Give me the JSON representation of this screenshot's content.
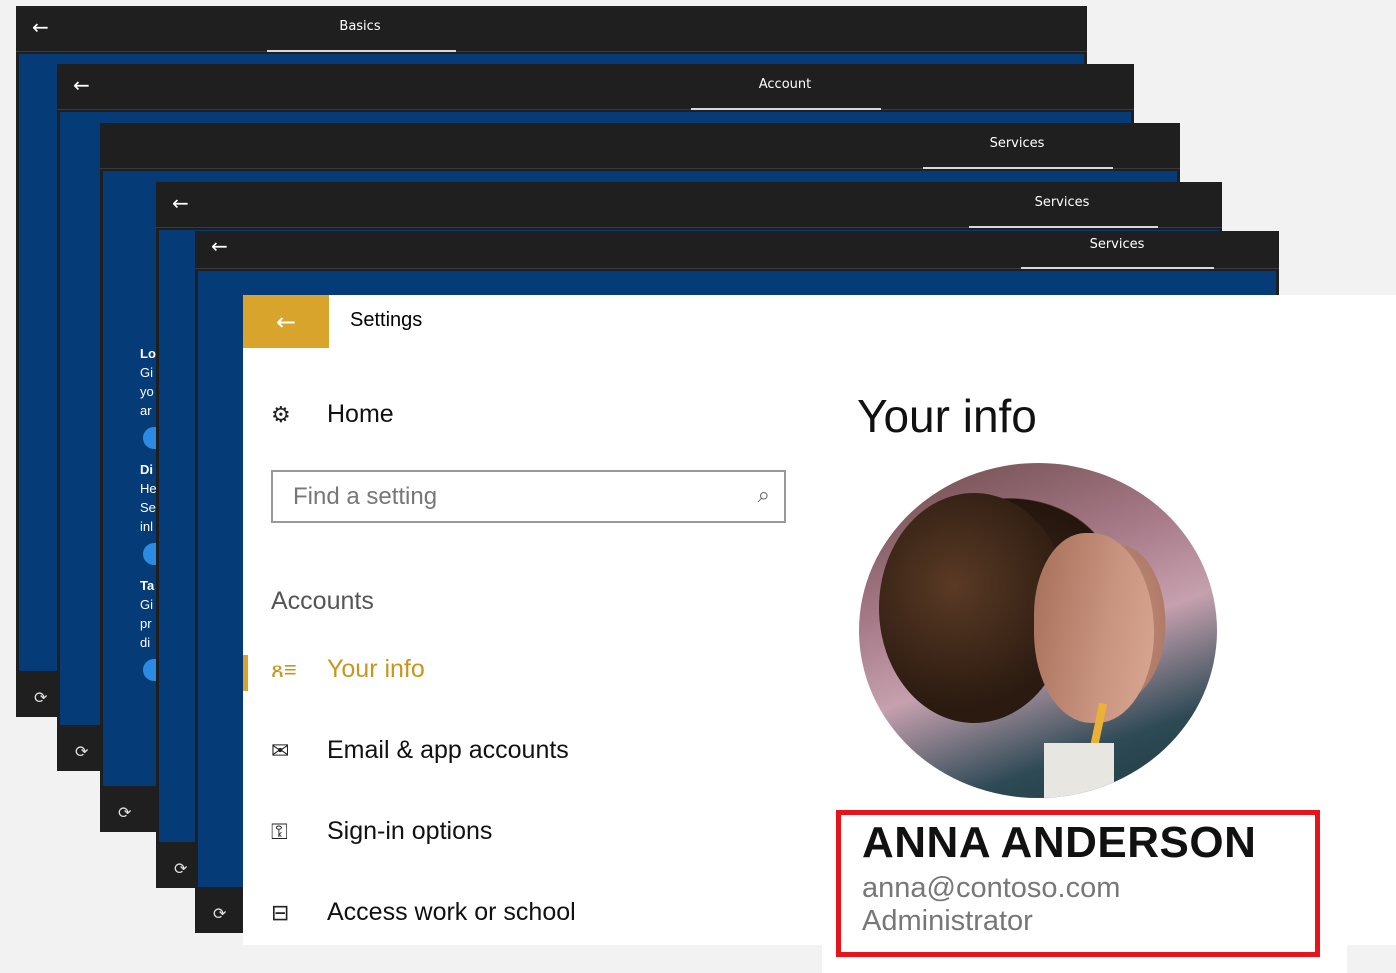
{
  "oobe_windows": [
    {
      "title": "Basics",
      "back": "←",
      "access": "⟳"
    },
    {
      "title": "Account",
      "back": "←",
      "access": "⟳"
    },
    {
      "title": "Services",
      "access": "⟳"
    },
    {
      "title": "Services",
      "back": "←",
      "access": "⟳"
    },
    {
      "title": "Services",
      "back": "←",
      "access": "⟳"
    }
  ],
  "oobe_fragments": {
    "h1": "Lo",
    "l1a": "Gi",
    "l1b": "yo",
    "l1c": "ar",
    "h2": "Di",
    "l2a": "He",
    "l2b": "Se",
    "l2c": "inl",
    "h3": "Ta",
    "l3a": "Gi",
    "l3b": "pr",
    "l3c": "di"
  },
  "settings": {
    "back_label": "←",
    "title": "Settings",
    "home_label": "Home",
    "home_icon": "gear-icon",
    "search_placeholder": "Find a setting",
    "section_label": "Accounts",
    "nav": [
      {
        "label": "Your info",
        "icon": "person-list-icon",
        "active": true
      },
      {
        "label": "Email & app accounts",
        "icon": "mail-icon",
        "active": false
      },
      {
        "label": "Sign-in options",
        "icon": "key-icon",
        "active": false
      },
      {
        "label": "Access work or school",
        "icon": "briefcase-icon",
        "active": false
      }
    ],
    "accent_color": "#d9a42b"
  },
  "your_info": {
    "heading": "Your info",
    "name": "ANNA ANDERSON",
    "email": "anna@contoso.com",
    "role": "Administrator",
    "highlight_color": "#e8141c"
  }
}
